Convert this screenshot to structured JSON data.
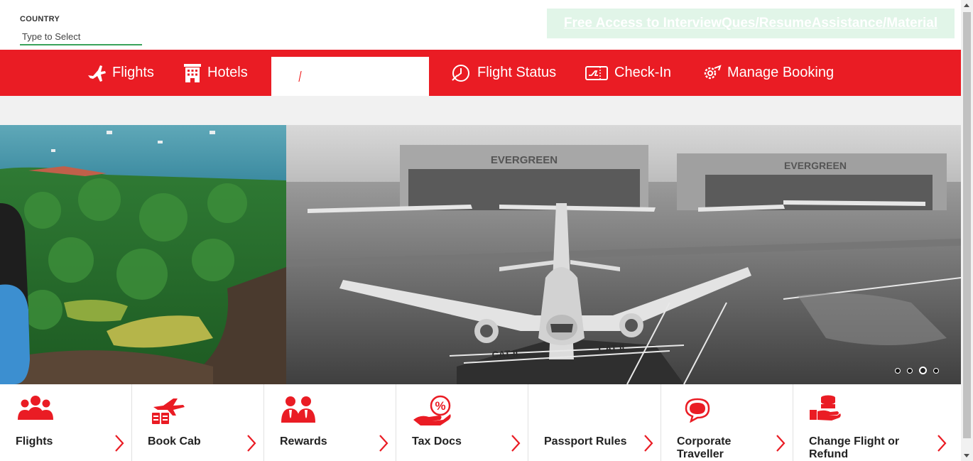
{
  "header": {
    "country_label": "COUNTRY",
    "country_placeholder": "Type to Select",
    "promo_text": "Free Access to InterviewQues/ResumeAssistance/Material"
  },
  "nav": {
    "flights": "Flights",
    "hotels": "Hotels",
    "flight_status": "Flight Status",
    "check_in": "Check-In",
    "manage_booking": "Manage Booking"
  },
  "hero": {
    "hangar_sign_1": "EVERGREEN",
    "hangar_sign_2": "EVERGREEN",
    "runway_mark": "CAT II",
    "slide_count": 4,
    "active_slide": 3
  },
  "tiles": [
    {
      "label": "Flights",
      "icon": "group-icon"
    },
    {
      "label": "Book Cab",
      "icon": "cab-icon"
    },
    {
      "label": "Rewards",
      "icon": "rewards-icon"
    },
    {
      "label": "Tax Docs",
      "icon": "tax-docs-icon"
    },
    {
      "label": "Passport Rules",
      "icon": ""
    },
    {
      "label": "Corporate Traveller",
      "icon": "chat-icon"
    },
    {
      "label": "Change Flight or Refund",
      "icon": "refund-icon"
    }
  ],
  "colors": {
    "brand_red": "#ea1c24",
    "promo_bg": "#e1f5e8",
    "input_underline": "#3aa35b"
  }
}
